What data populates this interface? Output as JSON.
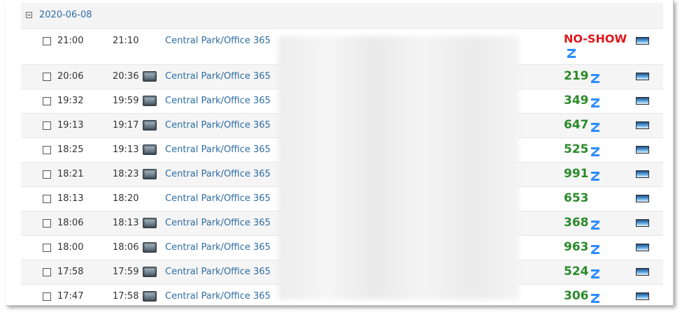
{
  "group": {
    "date": "2020-06-08"
  },
  "rows": [
    {
      "start": "21:00",
      "end": "21:10",
      "room": "Central Park/Office 365",
      "status": "NO-SHOW",
      "count": "",
      "device": false,
      "zoom": true
    },
    {
      "start": "20:06",
      "end": "20:36",
      "room": "Central Park/Office 365",
      "count": "219",
      "device": true,
      "zoom": true
    },
    {
      "start": "19:32",
      "end": "19:59",
      "room": "Central Park/Office 365",
      "count": "349",
      "device": true,
      "zoom": true
    },
    {
      "start": "19:13",
      "end": "19:17",
      "room": "Central Park/Office 365",
      "count": "647",
      "device": true,
      "zoom": true
    },
    {
      "start": "18:25",
      "end": "19:13",
      "room": "Central Park/Office 365",
      "count": "525",
      "device": true,
      "zoom": true
    },
    {
      "start": "18:21",
      "end": "18:23",
      "room": "Central Park/Office 365",
      "count": "991",
      "device": true,
      "zoom": true
    },
    {
      "start": "18:13",
      "end": "18:20",
      "room": "Central Park/Office 365",
      "count": "653",
      "device": false,
      "zoom": false
    },
    {
      "start": "18:06",
      "end": "18:13",
      "room": "Central Park/Office 365",
      "count": "368",
      "device": true,
      "zoom": true
    },
    {
      "start": "18:00",
      "end": "18:06",
      "room": "Central Park/Office 365",
      "count": "963",
      "device": true,
      "zoom": true
    },
    {
      "start": "17:58",
      "end": "17:59",
      "room": "Central Park/Office 365",
      "count": "524",
      "device": true,
      "zoom": true
    },
    {
      "start": "17:47",
      "end": "17:58",
      "room": "Central Park/Office 365",
      "count": "306",
      "device": true,
      "zoom": true
    }
  ],
  "colors": {
    "link": "#2e6da4",
    "count": "#2a8a2a",
    "noshow": "#e0161b",
    "zoom": "#2d8cff"
  },
  "icons": {
    "collapse": "minus-box-icon",
    "device": "monitor-icon",
    "zoom": "zoom-z-icon",
    "screen": "screen-preview-icon"
  }
}
